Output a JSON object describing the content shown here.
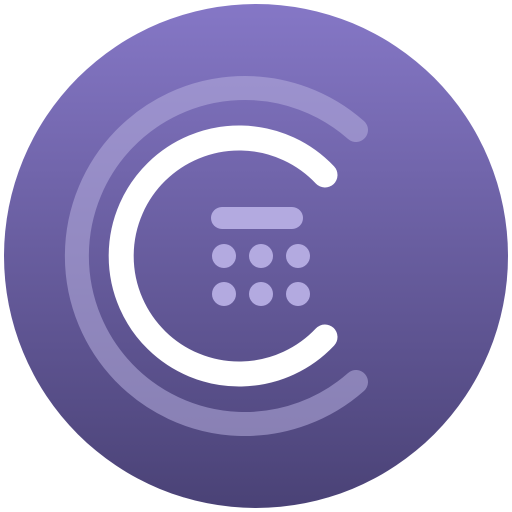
{
  "app_icon": {
    "shape": "circle",
    "colors": {
      "background_top": "#8577C6",
      "background_bottom": "#4A4276",
      "outer_ring": "#B7AEDF",
      "inner_glyph": "#FFFFFF",
      "keypad": "#B3AAE0"
    },
    "icon_names": [
      "app-badge-circle",
      "outer-arc-icon",
      "c-letter-icon",
      "calculator-display-bar-icon",
      "keypad-dot-icon"
    ],
    "keypad": {
      "rows": 2,
      "columns": 3
    }
  }
}
